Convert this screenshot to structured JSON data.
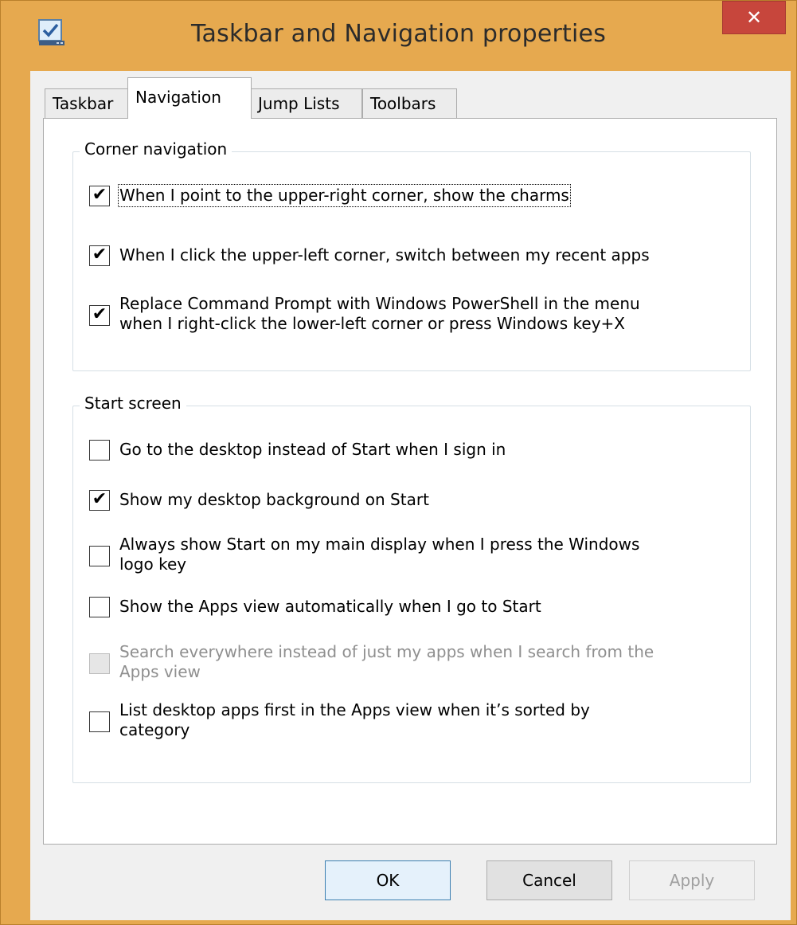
{
  "window": {
    "title": "Taskbar and Navigation properties",
    "close_label": "✕"
  },
  "tabs": [
    {
      "label": "Taskbar",
      "active": false
    },
    {
      "label": "Navigation",
      "active": true
    },
    {
      "label": "Jump Lists",
      "active": false
    },
    {
      "label": "Toolbars",
      "active": false
    }
  ],
  "corner_navigation": {
    "legend": "Corner navigation",
    "options": [
      {
        "label": "When I point to the upper-right corner, show the charms",
        "checked": true,
        "enabled": true
      },
      {
        "label": "When I click the upper-left corner, switch between my recent apps",
        "checked": true,
        "enabled": true
      },
      {
        "label": "Replace Command Prompt with Windows PowerShell in the menu\nwhen I right-click the lower-left corner or press Windows key+X",
        "checked": true,
        "enabled": true
      }
    ]
  },
  "start_screen": {
    "legend": "Start screen",
    "options": [
      {
        "label": "Go to the desktop instead of Start when I sign in",
        "checked": false,
        "enabled": true
      },
      {
        "label": "Show my desktop background on Start",
        "checked": true,
        "enabled": true
      },
      {
        "label": "Always show Start on my main display when I press the Windows\nlogo key",
        "checked": false,
        "enabled": true
      },
      {
        "label": "Show the Apps view automatically when I go to Start",
        "checked": false,
        "enabled": true
      },
      {
        "label": "Search everywhere instead of just my apps when I search from the\nApps view",
        "checked": false,
        "enabled": false
      },
      {
        "label": "List desktop apps first in the Apps view when it’s sorted by\ncategory",
        "checked": false,
        "enabled": true
      }
    ]
  },
  "buttons": {
    "ok": "OK",
    "cancel": "Cancel",
    "apply": "Apply"
  },
  "check_glyph": "✔"
}
